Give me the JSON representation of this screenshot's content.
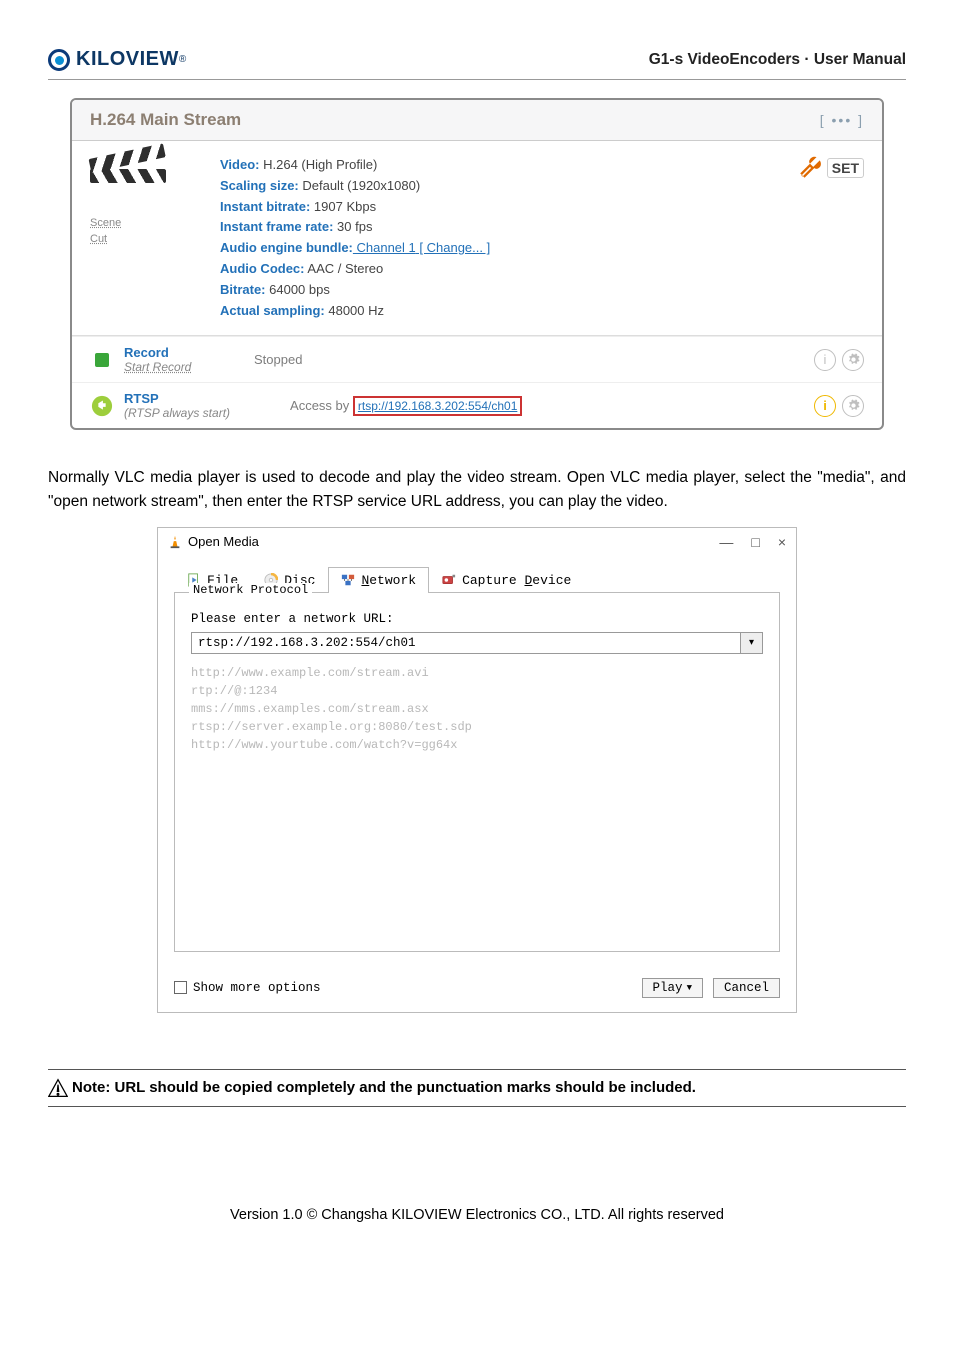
{
  "header": {
    "logo_text": "KILOVIEW",
    "product": "G1-s VideoEncoders · User Manual"
  },
  "panel": {
    "title": "H.264 Main Stream",
    "more": "[ ••• ]",
    "scene_link": "Scene",
    "cut_link": "Cut",
    "info": {
      "video_k": "Video:",
      "video_v": " H.264 (High Profile)",
      "scaling_k": "Scaling size:",
      "scaling_v": " Default (1920x1080)",
      "ibitrate_k": "Instant bitrate:",
      "ibitrate_v": " 1907 Kbps",
      "iframe_k": "Instant frame rate:",
      "iframe_v": " 30 fps",
      "audio_eng_k": "Audio engine bundle:",
      "audio_eng_v": " Channel 1",
      "audio_eng_chg": " [ Change... ]",
      "audio_codec_k": "Audio Codec:",
      "audio_codec_v": " AAC / Stereo",
      "bitrate_k": "Bitrate:",
      "bitrate_v": " 64000 bps",
      "sampling_k": "Actual sampling:",
      "sampling_v": " 48000 Hz"
    },
    "set_label": "SET",
    "record": {
      "title": "Record",
      "sub": "Start Record",
      "status": "Stopped"
    },
    "rtsp": {
      "title": "RTSP",
      "sub": "(RTSP always start)",
      "access_label": "Access by",
      "url": "rtsp://192.168.3.202:554/ch01"
    }
  },
  "paragraph": "Normally VLC media player is used to decode and play the video stream. Open VLC media player, select the \"media\", and \"open network stream\", then enter the RTSP service URL address, you can play the video.",
  "vlc": {
    "title": "Open Media",
    "win_min": "—",
    "win_max": "□",
    "win_close": "×",
    "tabs": {
      "file_pre": "",
      "file_u": "F",
      "file_post": "ile",
      "disc_pre": "",
      "disc_u": "D",
      "disc_post": "isc",
      "net_pre": "",
      "net_u": "N",
      "net_post": "etwork",
      "cap_pre": "Capture ",
      "cap_u": "D",
      "cap_post": "evice"
    },
    "legend": "Network Protocol",
    "prompt": "Please enter a network URL:",
    "input_value": "rtsp://192.168.3.202:554/ch01",
    "hints": [
      "http://www.example.com/stream.avi",
      "rtp://@:1234",
      "mms://mms.examples.com/stream.asx",
      "rtsp://server.example.org:8080/test.sdp",
      "http://www.yourtube.com/watch?v=gg64x"
    ],
    "show_more_pre": "Show ",
    "show_more_u": "m",
    "show_more_post": "ore options",
    "play_u": "P",
    "play_post": "lay",
    "cancel_u": "C",
    "cancel_post": "ancel"
  },
  "note": "Note: URL should be copied completely and the punctuation marks should be included.",
  "footer": "Version 1.0 © Changsha KILOVIEW Electronics CO., LTD. All rights reserved"
}
